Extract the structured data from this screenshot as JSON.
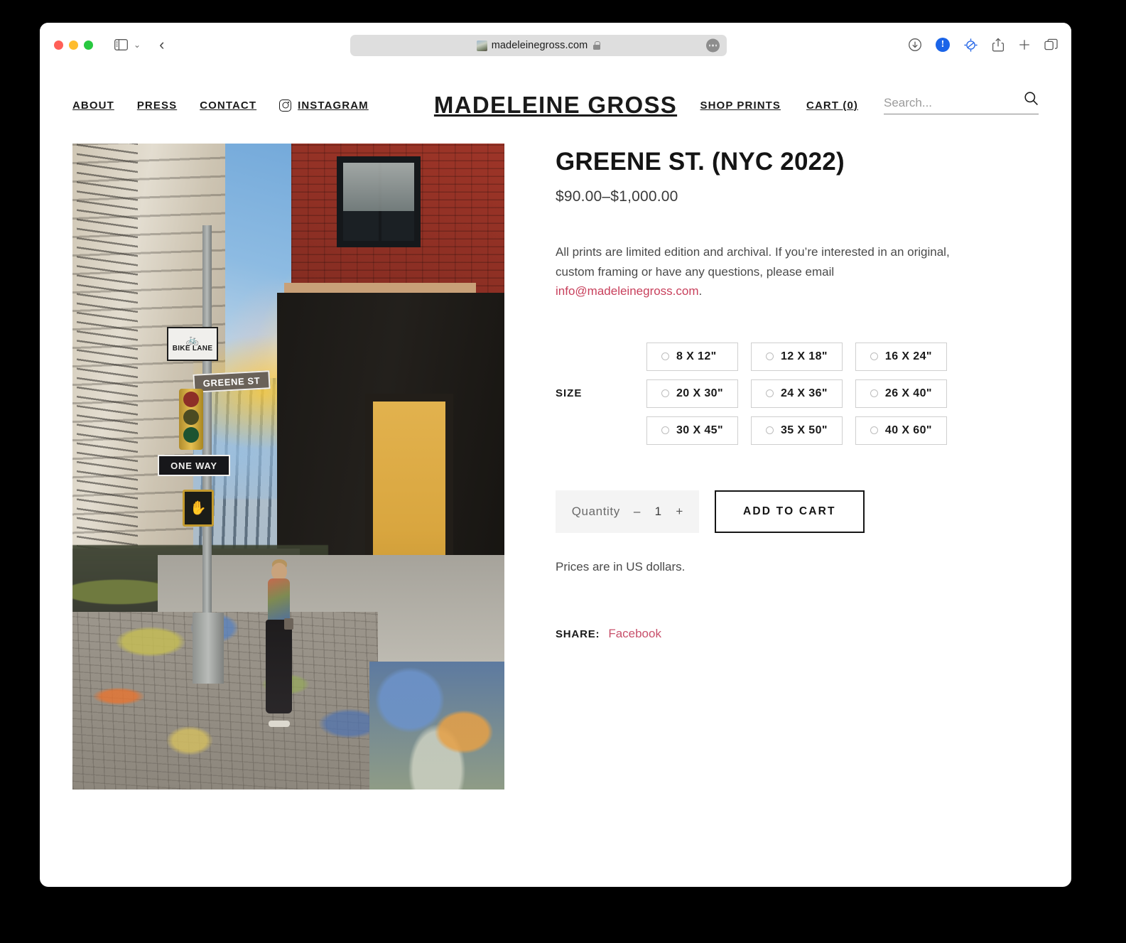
{
  "browser": {
    "url": "madeleinegross.com",
    "icons": {
      "sidebar": "sidebar-icon",
      "chevron": "chevron-down-icon",
      "back": "back-arrow-icon",
      "favicon": "site-favicon",
      "lock": "lock-icon",
      "ellipsis": "ellipsis-icon",
      "download": "download-icon",
      "alert_badge": "!",
      "privacy": "privacy-report-icon",
      "share": "share-icon",
      "new_tab": "+",
      "tabs_overview": "tabs-overview-icon"
    }
  },
  "header": {
    "brand": "MADELEINE GROSS",
    "nav_left": [
      {
        "label": "ABOUT"
      },
      {
        "label": "PRESS"
      },
      {
        "label": "CONTACT"
      },
      {
        "label": "INSTAGRAM",
        "icon": "instagram-icon"
      }
    ],
    "shop_prints": "SHOP PRINTS",
    "cart": "CART (0)",
    "search": {
      "placeholder": "Search...",
      "value": "",
      "icon": "search-icon"
    }
  },
  "product": {
    "title": "GREENE ST. (NYC 2022)",
    "price": "$90.00–$1,000.00",
    "description_part1": "All prints are limited edition and archival. If you’re interested in an original, custom framing or have any questions, please email ",
    "description_email": "info@madeleinegross.com",
    "description_part2": ".",
    "size_label": "SIZE",
    "sizes": [
      {
        "label": "8 X 12\"",
        "selected": false
      },
      {
        "label": "12 X 18\"",
        "selected": false
      },
      {
        "label": "16 X 24\"",
        "selected": false
      },
      {
        "label": "20 X 30\"",
        "selected": false
      },
      {
        "label": "24 X 36\"",
        "selected": false
      },
      {
        "label": "26 X 40\"",
        "selected": false
      },
      {
        "label": "30 X 45\"",
        "selected": false
      },
      {
        "label": "35 X 50\"",
        "selected": false
      },
      {
        "label": "40 X 60\"",
        "selected": false
      }
    ],
    "quantity": {
      "label": "Quantity",
      "minus": "–",
      "value": "1",
      "plus": "+"
    },
    "add_to_cart": "ADD TO CART",
    "prices_note": "Prices are in US dollars.",
    "share_label": "SHARE:",
    "share_link": "Facebook",
    "artwork": {
      "alt": "Painted photograph of Greene St. in SoHo NYC",
      "signs": {
        "bike_lane": "BIKE LANE",
        "street": "GREENE ST",
        "one_way": "ONE WAY"
      }
    }
  },
  "colors": {
    "accent_link": "#c8405c",
    "share_link": "#c8506b",
    "text": "#1a1a1a",
    "muted": "#4a4a4a",
    "border": "#cfcfcf"
  }
}
